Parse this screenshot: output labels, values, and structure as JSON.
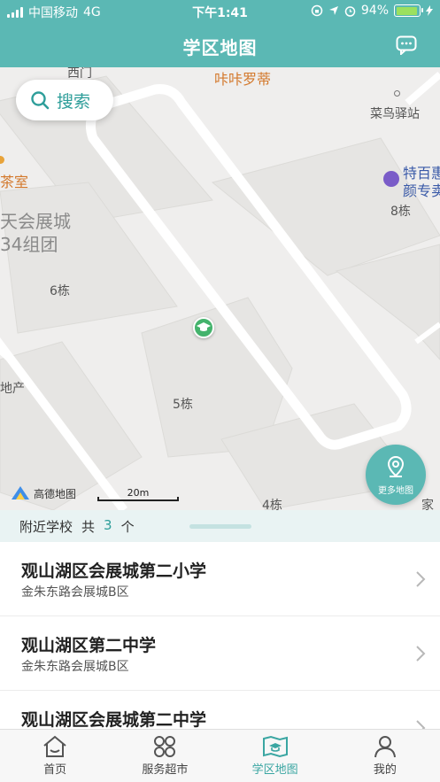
{
  "status": {
    "carrier": "中国移动",
    "network": "4G",
    "time": "下午1:41",
    "battery": "94%"
  },
  "nav": {
    "title": "学区地图"
  },
  "map": {
    "search_label": "搜索",
    "more_map_label": "更多地图",
    "logo_text": "高德地图",
    "scale_label": "20m",
    "labels": {
      "ximen": "西门",
      "kafei": "咔咔罗蒂",
      "cainiao": "菜鸟驿站",
      "chashi": "茶室",
      "tebaihui": "特百惠",
      "yanzhuan": "颜专卖",
      "huizhan1": "天会展城",
      "huizhan2": "34组团",
      "b8": "8栋",
      "b6": "6栋",
      "b5": "5栋",
      "b4": "4栋",
      "dichan": "地产",
      "jia": "家"
    }
  },
  "nearby": {
    "label": "附近学校",
    "gong": "共",
    "count": "3",
    "unit": "个"
  },
  "schools": [
    {
      "name": "观山湖区会展城第二小学",
      "address": "金朱东路会展城B区"
    },
    {
      "name": "观山湖区第二中学",
      "address": "金朱东路会展城B区"
    },
    {
      "name": "观山湖区会展城第二中学",
      "address": ""
    }
  ],
  "tabs": [
    {
      "label": "首页"
    },
    {
      "label": "服务超市"
    },
    {
      "label": "学区地图"
    },
    {
      "label": "我的"
    }
  ],
  "colors": {
    "primary": "#5bb8b4",
    "accent_text": "#2e9e9a",
    "pin": "#44b36c"
  }
}
